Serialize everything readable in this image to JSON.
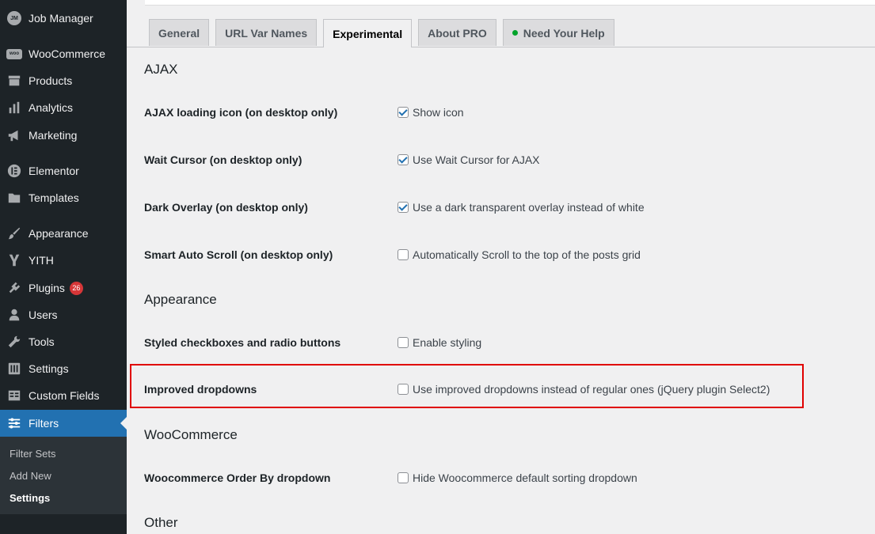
{
  "sidebar": {
    "items": [
      {
        "label": "Job Manager",
        "icon": "job-manager-logo-icon",
        "logo_text": "JM"
      },
      {
        "label": "WooCommerce",
        "icon": "woocommerce-icon",
        "logo_text": "woo"
      },
      {
        "label": "Products",
        "icon": "archive-icon"
      },
      {
        "label": "Analytics",
        "icon": "bar-chart-icon"
      },
      {
        "label": "Marketing",
        "icon": "megaphone-icon"
      },
      {
        "label": "Elementor",
        "icon": "elementor-icon"
      },
      {
        "label": "Templates",
        "icon": "folder-icon"
      },
      {
        "label": "Appearance",
        "icon": "paintbrush-icon"
      },
      {
        "label": "YITH",
        "icon": "yith-icon"
      },
      {
        "label": "Plugins",
        "icon": "plugin-icon",
        "badge": "26"
      },
      {
        "label": "Users",
        "icon": "user-icon"
      },
      {
        "label": "Tools",
        "icon": "wrench-icon"
      },
      {
        "label": "Settings",
        "icon": "settings-sliders-icon"
      },
      {
        "label": "Custom Fields",
        "icon": "custom-fields-icon"
      },
      {
        "label": "Filters",
        "icon": "filter-sliders-icon",
        "active": true
      }
    ],
    "submenu": [
      {
        "label": "Filter Sets"
      },
      {
        "label": "Add New"
      },
      {
        "label": "Settings",
        "current": true
      }
    ]
  },
  "tabs": [
    {
      "label": "General"
    },
    {
      "label": "URL Var Names"
    },
    {
      "label": "Experimental",
      "active": true
    },
    {
      "label": "About PRO"
    },
    {
      "label": "Need Your Help",
      "status_dot_color": "#00a32a"
    }
  ],
  "sections": {
    "ajax": {
      "title": "AJAX",
      "rows": [
        {
          "label": "AJAX loading icon (on desktop only)",
          "option": "Show icon",
          "checked": true
        },
        {
          "label": "Wait Cursor (on desktop only)",
          "option": "Use Wait Cursor for AJAX",
          "checked": true
        },
        {
          "label": "Dark Overlay (on desktop only)",
          "option": "Use a dark transparent overlay instead of white",
          "checked": true
        },
        {
          "label": "Smart Auto Scroll (on desktop only)",
          "option": "Automatically Scroll to the top of the posts grid",
          "checked": false
        }
      ]
    },
    "appearance": {
      "title": "Appearance",
      "rows": [
        {
          "label": "Styled checkboxes and radio buttons",
          "option": "Enable styling",
          "checked": false
        },
        {
          "label": "Improved dropdowns",
          "option": "Use improved dropdowns instead of regular ones (jQuery plugin Select2)",
          "checked": false
        }
      ]
    },
    "woocommerce": {
      "title": "WooCommerce",
      "rows": [
        {
          "label": "Woocommerce Order By dropdown",
          "option": "Hide Woocommerce default sorting dropdown",
          "checked": false
        }
      ]
    },
    "other": {
      "title": "Other"
    }
  },
  "colors": {
    "sidebar_bg": "#1d2327",
    "active_menu": "#2271b1",
    "highlight_box": "#e00000",
    "badge": "#d63638"
  }
}
